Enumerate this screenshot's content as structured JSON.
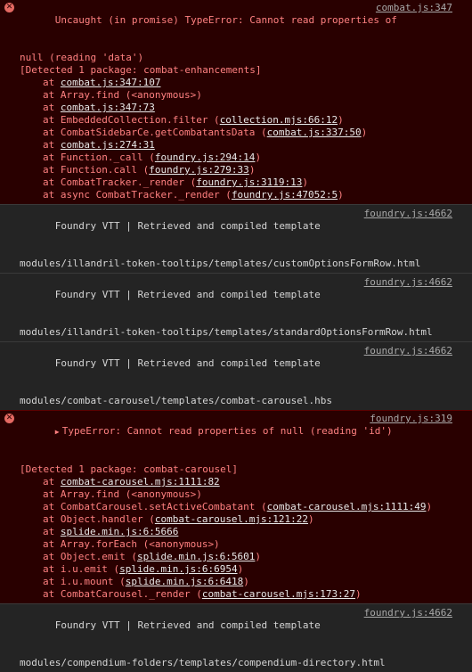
{
  "entries": [
    {
      "type": "error",
      "message_line1": "Uncaught (in promise) TypeError: Cannot read properties of",
      "message_line2": "null (reading 'data')",
      "detected": "[Detected 1 package: combat-enhancements]",
      "source": "combat.js:347",
      "frames": [
        {
          "prefix": "at ",
          "fn": "",
          "link": "combat.js:347:107",
          "suffix": ""
        },
        {
          "prefix": "at ",
          "fn": "Array.find (<anonymous>)",
          "link": "",
          "suffix": ""
        },
        {
          "prefix": "at ",
          "fn": "",
          "link": "combat.js:347:73",
          "suffix": ""
        },
        {
          "prefix": "at ",
          "fn": "EmbeddedCollection.filter (",
          "link": "collection.mjs:66:12",
          "suffix": ")"
        },
        {
          "prefix": "at ",
          "fn": "CombatSidebarCe.getCombatantsData (",
          "link": "combat.js:337:50",
          "suffix": ")"
        },
        {
          "prefix": "at ",
          "fn": "",
          "link": "combat.js:274:31",
          "suffix": ""
        },
        {
          "prefix": "at ",
          "fn": "Function._call (",
          "link": "foundry.js:294:14",
          "suffix": ")"
        },
        {
          "prefix": "at ",
          "fn": "Function.call (",
          "link": "foundry.js:279:33",
          "suffix": ")"
        },
        {
          "prefix": "at ",
          "fn": "CombatTracker._render (",
          "link": "foundry.js:3119:13",
          "suffix": ")"
        },
        {
          "prefix": "at ",
          "fn": "async CombatTracker._render (",
          "link": "foundry.js:47052:5",
          "suffix": ")"
        }
      ]
    },
    {
      "type": "log",
      "line1": "Foundry VTT | Retrieved and compiled template",
      "line2": "modules/illandril-token-tooltips/templates/customOptionsFormRow.html",
      "source": "foundry.js:4662"
    },
    {
      "type": "log",
      "line1": "Foundry VTT | Retrieved and compiled template",
      "line2": "modules/illandril-token-tooltips/templates/standardOptionsFormRow.html",
      "source": "foundry.js:4662"
    },
    {
      "type": "log",
      "line1": "Foundry VTT | Retrieved and compiled template",
      "line2": "modules/combat-carousel/templates/combat-carousel.hbs",
      "source": "foundry.js:4662"
    },
    {
      "type": "error",
      "message_line1": "TypeError: Cannot read properties of null (reading 'id')",
      "detected": "[Detected 1 package: combat-carousel]",
      "source": "foundry.js:319",
      "frames": [
        {
          "prefix": "at ",
          "fn": "",
          "link": "combat-carousel.mjs:1111:82",
          "suffix": ""
        },
        {
          "prefix": "at ",
          "fn": "Array.find (<anonymous>)",
          "link": "",
          "suffix": ""
        },
        {
          "prefix": "at ",
          "fn": "CombatCarousel.setActiveCombatant (",
          "link": "combat-carousel.mjs:1111:49",
          "suffix": ")"
        },
        {
          "prefix": "at ",
          "fn": "Object.handler (",
          "link": "combat-carousel.mjs:121:22",
          "suffix": ")"
        },
        {
          "prefix": "at ",
          "fn": "",
          "link": "splide.min.js:6:5666",
          "suffix": ""
        },
        {
          "prefix": "at ",
          "fn": "Array.forEach (<anonymous>)",
          "link": "",
          "suffix": ""
        },
        {
          "prefix": "at ",
          "fn": "Object.emit (",
          "link": "splide.min.js:6:5601",
          "suffix": ")"
        },
        {
          "prefix": "at ",
          "fn": "i.u.emit (",
          "link": "splide.min.js:6:6954",
          "suffix": ")"
        },
        {
          "prefix": "at ",
          "fn": "i.u.mount (",
          "link": "splide.min.js:6:6418",
          "suffix": ")"
        },
        {
          "prefix": "at ",
          "fn": "CombatCarousel._render (",
          "link": "combat-carousel.mjs:173:27",
          "suffix": ")"
        }
      ]
    },
    {
      "type": "log",
      "line1": "Foundry VTT | Retrieved and compiled template",
      "line2": "modules/compendium-folders/templates/compendium-directory.html",
      "source": "foundry.js:4662"
    }
  ],
  "icons": {
    "error": "error-circle-x-icon",
    "expand": "expand-triangle-icon"
  },
  "colors": {
    "error_bg": "#290000",
    "error_text": "#ff8080",
    "log_bg": "#242424",
    "log_text": "#d5d5d5"
  }
}
